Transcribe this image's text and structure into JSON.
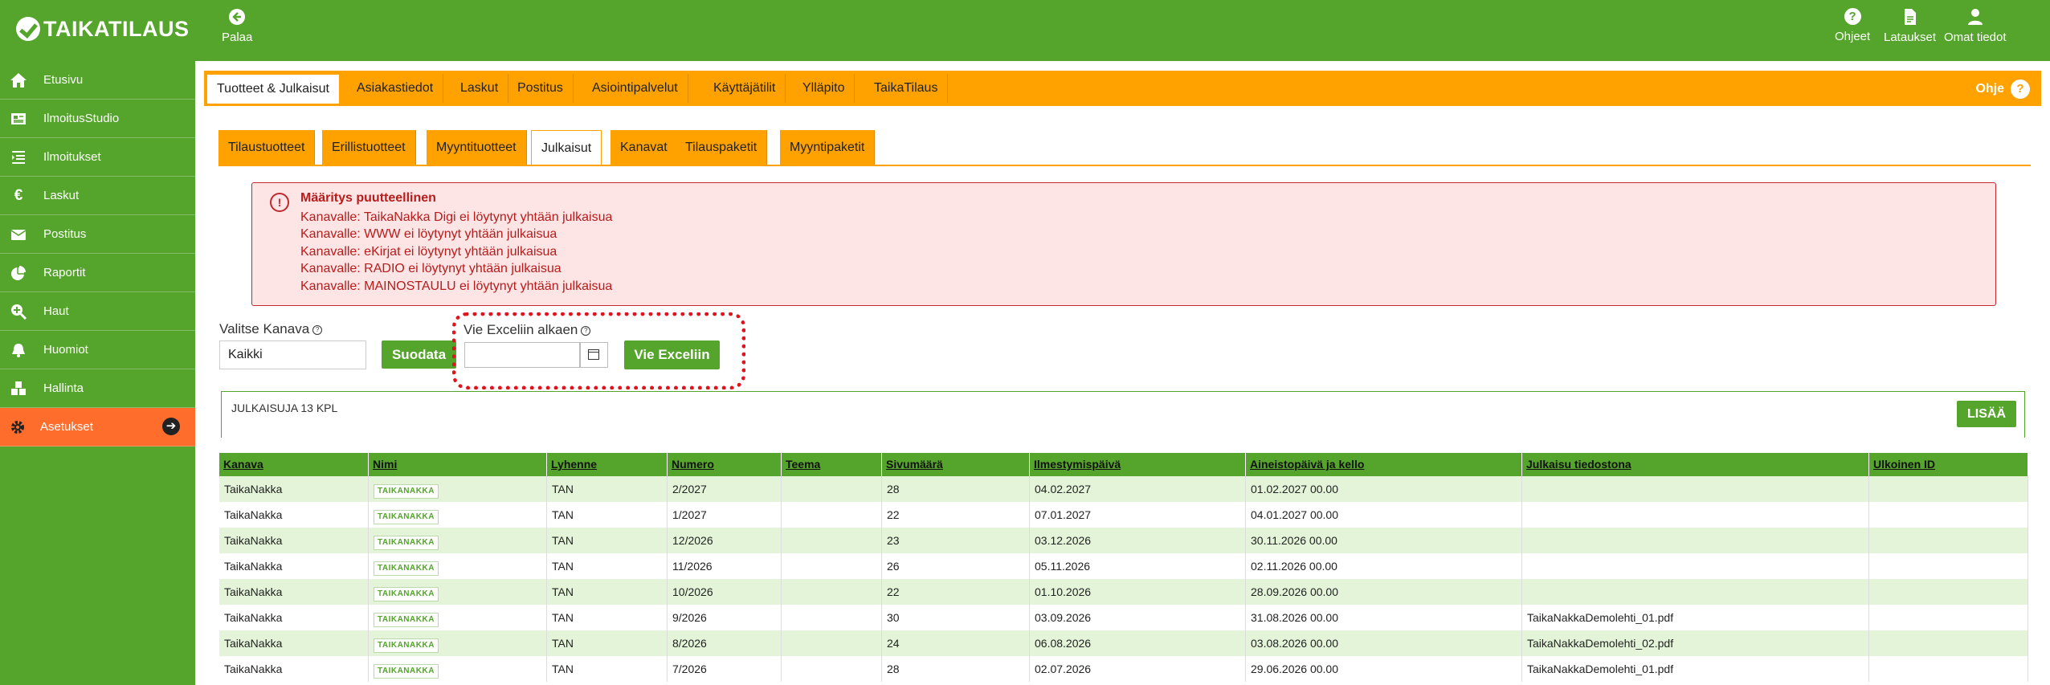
{
  "app": {
    "logo_text": "TAIKATILAUS"
  },
  "topbar": {
    "back_label": "Palaa",
    "help_label": "Ohjeet",
    "downloads_label": "Lataukset",
    "profile_label": "Omat tiedot"
  },
  "sidebar": {
    "items": [
      {
        "label": "Etusivu",
        "icon": "home-icon"
      },
      {
        "label": "IlmoitusStudio",
        "icon": "newspaper-icon"
      },
      {
        "label": "Ilmoitukset",
        "icon": "list-icon"
      },
      {
        "label": "Laskut",
        "icon": "euro-icon"
      },
      {
        "label": "Postitus",
        "icon": "mail-icon"
      },
      {
        "label": "Raportit",
        "icon": "pie-chart-icon"
      },
      {
        "label": "Haut",
        "icon": "search-plus-icon"
      },
      {
        "label": "Huomiot",
        "icon": "bell-icon"
      },
      {
        "label": "Hallinta",
        "icon": "cubes-icon"
      },
      {
        "label": "Asetukset",
        "icon": "gear-icon",
        "active": true
      }
    ]
  },
  "main_tabs": {
    "items": [
      "Tuotteet & Julkaisut",
      "Asiakastiedot",
      "Laskut",
      "Postitus",
      "Asiointipalvelut",
      "Käyttäjätilit",
      "Ylläpito",
      "TaikaTilaus"
    ],
    "active": "Tuotteet & Julkaisut",
    "help_label": "Ohje"
  },
  "sub_tabs": {
    "items": [
      "Tilaustuotteet",
      "Erillistuotteet",
      "Myyntituotteet",
      "Julkaisut",
      "Kanavat",
      "Tilauspaketit",
      "Myyntipaketit"
    ],
    "active": "Julkaisut"
  },
  "alert": {
    "title": "Määritys puutteellinen",
    "lines": [
      "Kanavalle: TaikaNakka Digi ei löytynyt yhtään julkaisua",
      "Kanavalle: WWW ei löytynyt yhtään julkaisua",
      "Kanavalle: eKirjat ei löytynyt yhtään julkaisua",
      "Kanavalle: RADIO ei löytynyt yhtään julkaisua",
      "Kanavalle: MAINOSTAULU ei löytynyt yhtään julkaisua"
    ]
  },
  "filters": {
    "channel_label": "Valitse Kanava",
    "channel_value": "Kaikki",
    "filter_button": "Suodata",
    "excel_label": "Vie Exceliin alkaen",
    "excel_value": "",
    "excel_button": "Vie Exceliin"
  },
  "list": {
    "count_label": "JULKAISUJA 13 KPL",
    "add_button": "LISÄÄ"
  },
  "table": {
    "columns": [
      "Kanava",
      "Nimi",
      "Lyhenne",
      "Numero",
      "Teema",
      "Sivumäärä",
      "Ilmestymispäivä",
      "Aineistopäivä ja kello",
      "Julkaisu tiedostona",
      "Ulkoinen ID"
    ],
    "rows": [
      [
        "TaikaNakka",
        "TAIKANAKKA",
        "TAN",
        "2/2027",
        "",
        "28",
        "04.02.2027",
        "01.02.2027 00.00",
        "",
        ""
      ],
      [
        "TaikaNakka",
        "TAIKANAKKA",
        "TAN",
        "1/2027",
        "",
        "22",
        "07.01.2027",
        "04.01.2027 00.00",
        "",
        ""
      ],
      [
        "TaikaNakka",
        "TAIKANAKKA",
        "TAN",
        "12/2026",
        "",
        "23",
        "03.12.2026",
        "30.11.2026 00.00",
        "",
        ""
      ],
      [
        "TaikaNakka",
        "TAIKANAKKA",
        "TAN",
        "11/2026",
        "",
        "26",
        "05.11.2026",
        "02.11.2026 00.00",
        "",
        ""
      ],
      [
        "TaikaNakka",
        "TAIKANAKKA",
        "TAN",
        "10/2026",
        "",
        "22",
        "01.10.2026",
        "28.09.2026 00.00",
        "",
        ""
      ],
      [
        "TaikaNakka",
        "TAIKANAKKA",
        "TAN",
        "9/2026",
        "",
        "30",
        "03.09.2026",
        "31.08.2026 00.00",
        "TaikaNakkaDemolehti_01.pdf",
        ""
      ],
      [
        "TaikaNakka",
        "TAIKANAKKA",
        "TAN",
        "8/2026",
        "",
        "24",
        "06.08.2026",
        "03.08.2026 00.00",
        "TaikaNakkaDemolehti_02.pdf",
        ""
      ],
      [
        "TaikaNakka",
        "TAIKANAKKA",
        "TAN",
        "7/2026",
        "",
        "28",
        "02.07.2026",
        "29.06.2026 00.00",
        "TaikaNakkaDemolehti_01.pdf",
        ""
      ]
    ]
  },
  "colors": {
    "brand_green": "#55a42b",
    "tab_orange": "#ffa200",
    "active_side": "#ff6d2d",
    "alert_red": "#b71c1c",
    "row_alt": "#e3f4d8"
  }
}
